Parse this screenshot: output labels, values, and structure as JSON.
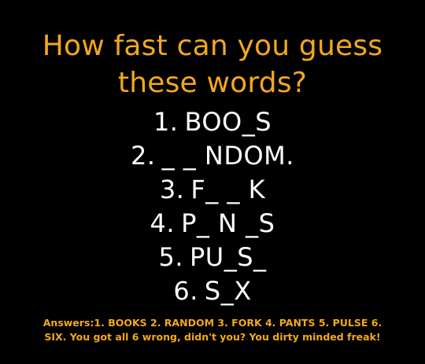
{
  "title": {
    "line1": "How fast can you guess",
    "line2": "these words?"
  },
  "puzzles": [
    {
      "number": "1.",
      "pattern": "BOO_S"
    },
    {
      "number": "2.",
      "pattern": "_ _ NDOM."
    },
    {
      "number": "3.",
      "pattern": "F_ _ K"
    },
    {
      "number": "4.",
      "pattern": "P_ N _S"
    },
    {
      "number": "5.",
      "pattern": "PU_S_"
    },
    {
      "number": "6.",
      "pattern": "S_X"
    }
  ],
  "answers": {
    "line1": "Answers:1. BOOKS 2. RANDOM 3. FORK 4. PANTS 5. PULSE 6.",
    "line2": "SIX. You got all 6 wrong, didn't you? You dirty minded freak!"
  },
  "colors": {
    "background": "#000000",
    "title": "#f2a81d",
    "puzzle_text": "#ffffff",
    "answers": "#f2a81d"
  }
}
